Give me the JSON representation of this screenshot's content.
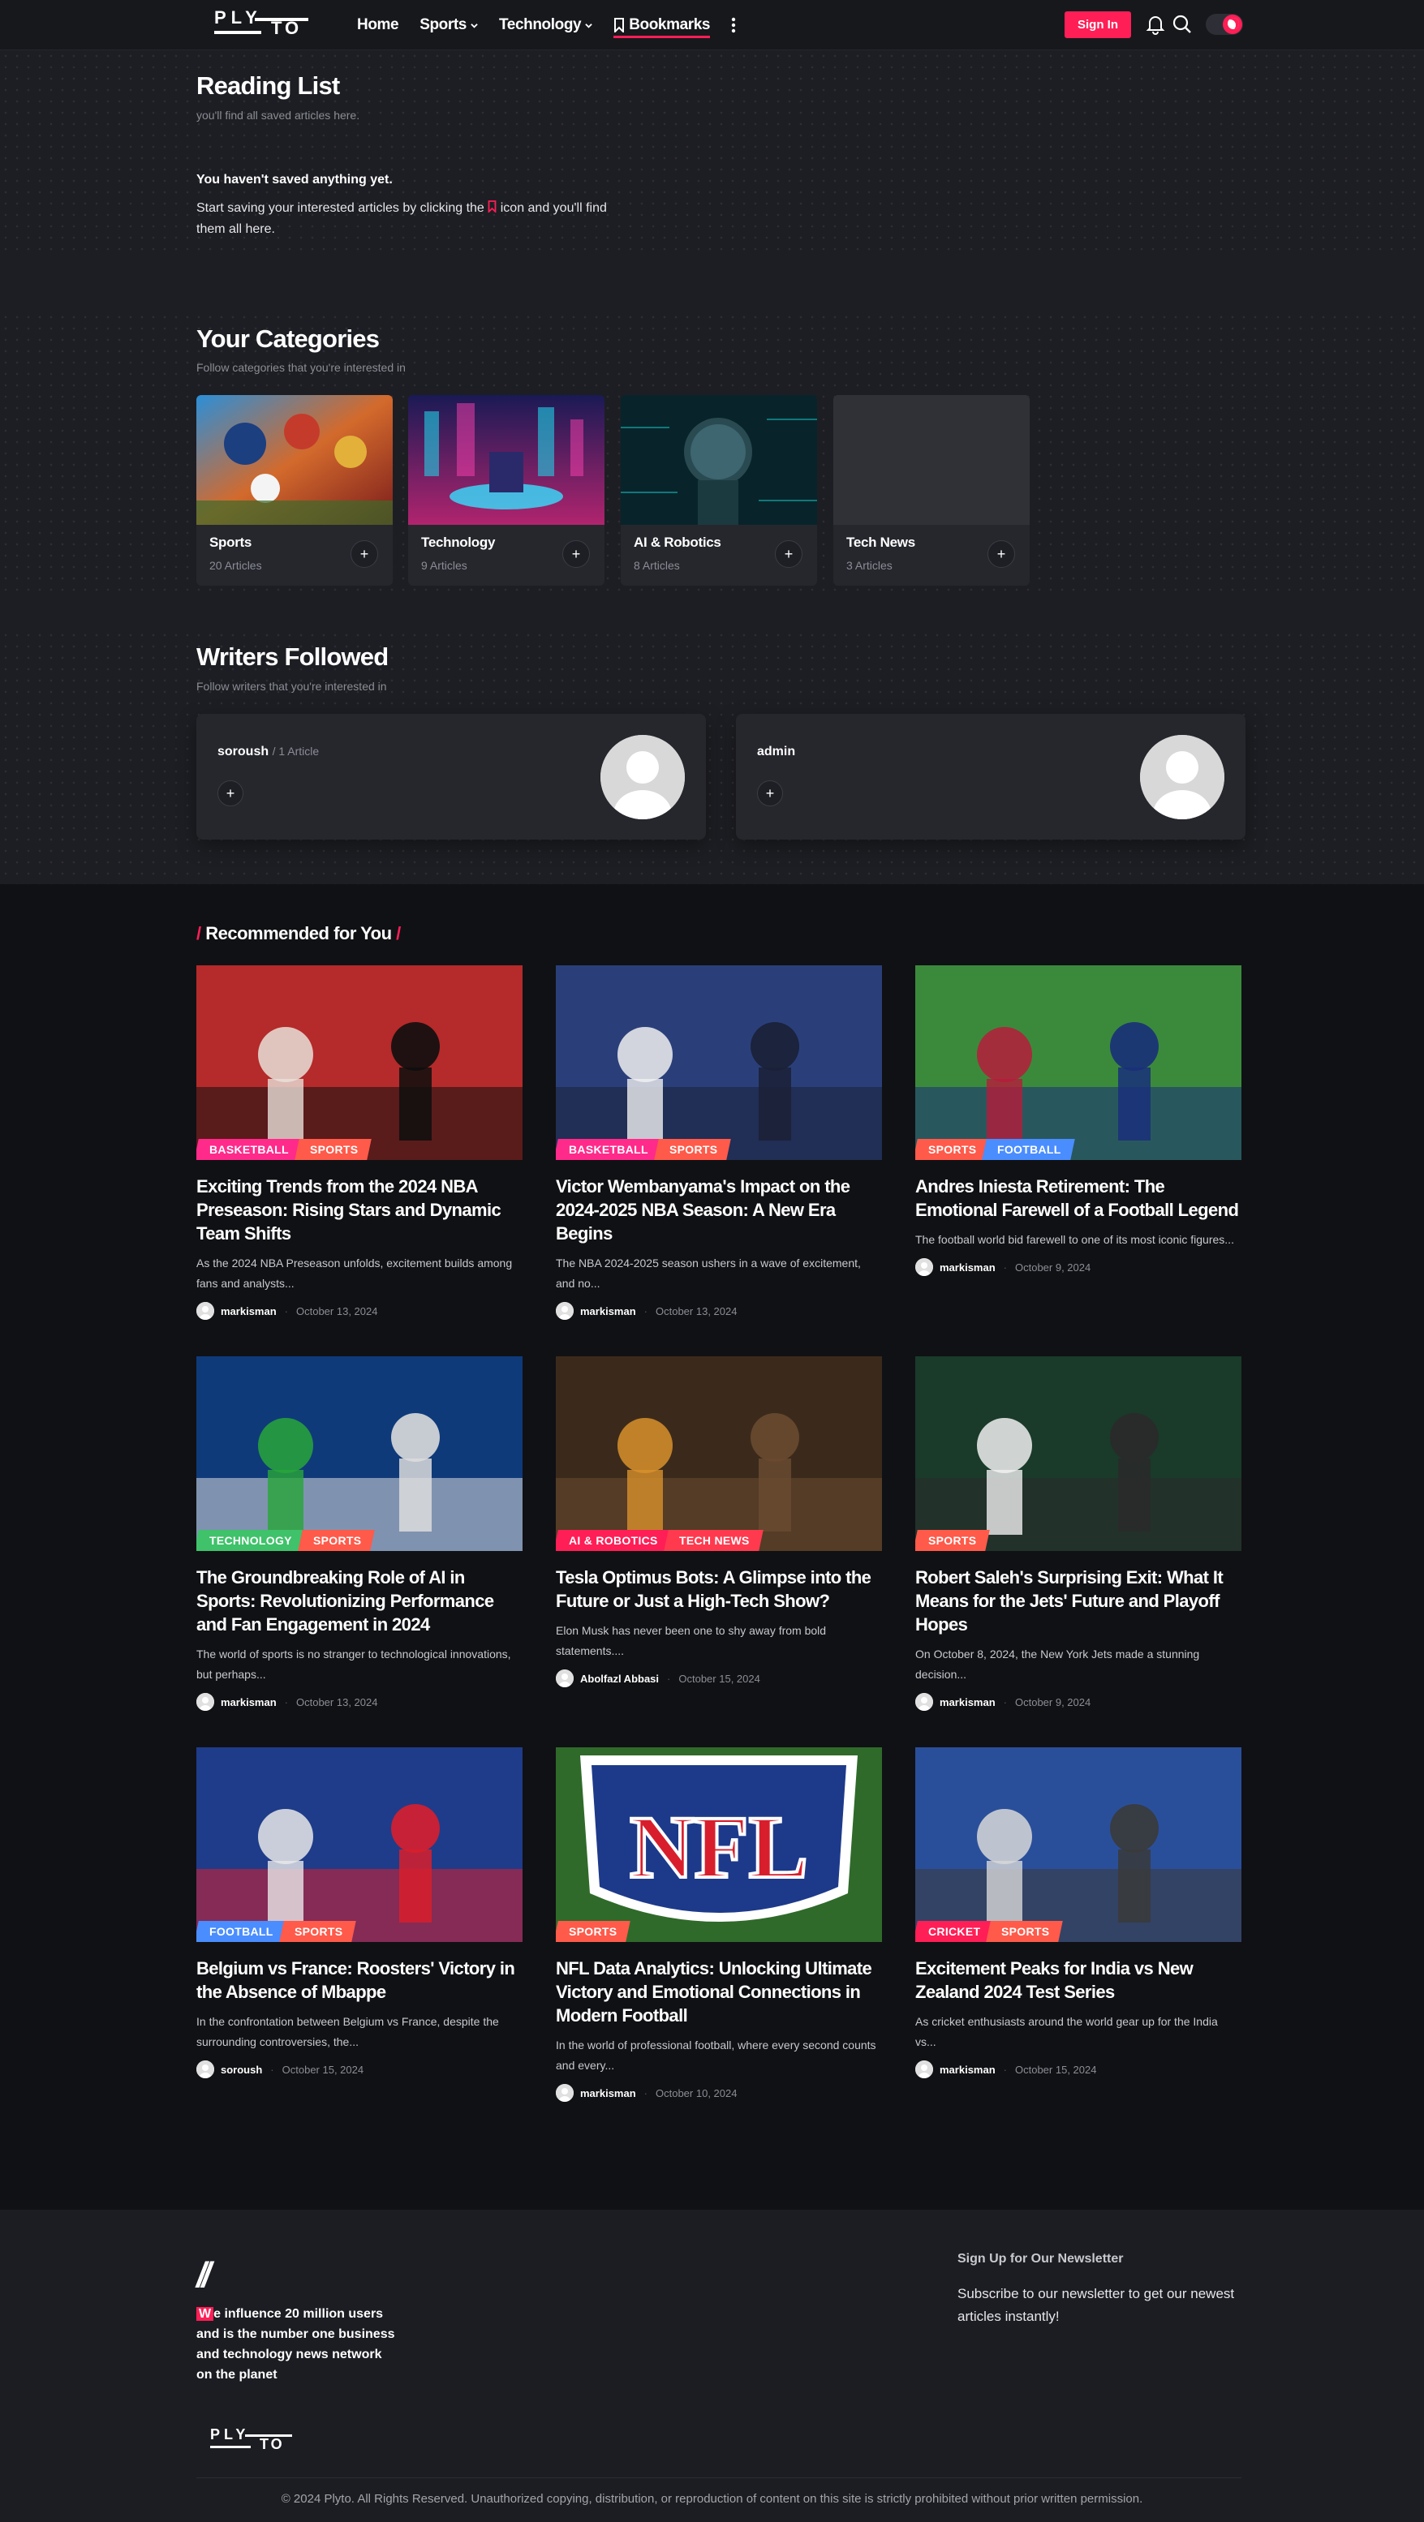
{
  "header": {
    "logo_text": "PLYTO",
    "nav": [
      {
        "label": "Home",
        "has_chevron": false
      },
      {
        "label": "Sports",
        "has_chevron": true
      },
      {
        "label": "Technology",
        "has_chevron": true
      },
      {
        "label": "Bookmarks",
        "has_chevron": false,
        "active": true
      }
    ],
    "signin_label": "Sign In",
    "accent_color": "#ff1e56"
  },
  "reading_list": {
    "title": "Reading List",
    "subtitle": "you'll find all saved articles here.",
    "empty_title": "You haven't saved anything yet.",
    "empty_text_before": "Start saving your interested articles by clicking the",
    "empty_text_after": "icon and you'll find them all here."
  },
  "categories": {
    "title": "Your Categories",
    "subtitle": "Follow categories that you're interested in",
    "items": [
      {
        "name": "Sports",
        "count": "20 Articles"
      },
      {
        "name": "Technology",
        "count": "9 Articles"
      },
      {
        "name": "AI & Robotics",
        "count": "8 Articles"
      },
      {
        "name": "Tech News",
        "count": "3 Articles"
      }
    ]
  },
  "writers": {
    "title": "Writers Followed",
    "subtitle": "Follow writers that you're interested in",
    "items": [
      {
        "name": "soroush",
        "meta": "/ 1 Article"
      },
      {
        "name": "admin",
        "meta": ""
      }
    ]
  },
  "recommended": {
    "title": "Recommended for You",
    "tag_colors": {
      "BASKETBALL": "#ff2a8a",
      "SPORTS": "#ff5a4a",
      "FOOTBALL": "#4a8dff",
      "TECHNOLOGY": "#3fc26a",
      "AI & ROBOTICS": "#ff1e56",
      "TECH NEWS": "#ff3a4f",
      "CRICKET": "#ff1e56"
    },
    "posts": [
      {
        "tags": [
          "BASKETBALL",
          "SPORTS"
        ],
        "title": "Exciting Trends from the 2024 NBA Preseason: Rising Stars and Dynamic Team Shifts",
        "excerpt": "As the 2024 NBA Preseason unfolds, excitement builds among fans and analysts...",
        "author": "markisman",
        "date": "October 13, 2024"
      },
      {
        "tags": [
          "BASKETBALL",
          "SPORTS"
        ],
        "title": "Victor Wembanyama's Impact on the 2024-2025 NBA Season: A New Era Begins",
        "excerpt": "The NBA 2024-2025 season ushers in a wave of excitement, and no...",
        "author": "markisman",
        "date": "October 13, 2024"
      },
      {
        "tags": [
          "SPORTS",
          "FOOTBALL"
        ],
        "title": "Andres Iniesta Retirement: The Emotional Farewell of a Football Legend",
        "excerpt": "The football world bid farewell to one of its most iconic figures...",
        "author": "markisman",
        "date": "October 9, 2024"
      },
      {
        "tags": [
          "TECHNOLOGY",
          "SPORTS"
        ],
        "title": "The Groundbreaking Role of AI in Sports: Revolutionizing Performance and Fan Engagement in 2024",
        "excerpt": "The world of sports is no stranger to technological innovations, but perhaps...",
        "author": "markisman",
        "date": "October 13, 2024"
      },
      {
        "tags": [
          "AI & ROBOTICS",
          "TECH NEWS"
        ],
        "title": "Tesla Optimus Bots: A Glimpse into the Future or Just a High-Tech Show?",
        "excerpt": "Elon Musk has never been one to shy away from bold statements....",
        "author": "Abolfazl Abbasi",
        "date": "October 15, 2024"
      },
      {
        "tags": [
          "SPORTS"
        ],
        "title": "Robert Saleh's Surprising Exit: What It Means for the Jets' Future and Playoff Hopes",
        "excerpt": "On October 8, 2024, the New York Jets made a stunning decision...",
        "author": "markisman",
        "date": "October 9, 2024"
      },
      {
        "tags": [
          "FOOTBALL",
          "SPORTS"
        ],
        "title": "Belgium vs France: Roosters' Victory in the Absence of Mbappe",
        "excerpt": "In the confrontation between Belgium vs France, despite the surrounding controversies, the...",
        "author": "soroush",
        "date": "October 15, 2024"
      },
      {
        "tags": [
          "SPORTS"
        ],
        "title": "NFL Data Analytics: Unlocking Ultimate Victory and Emotional Connections in Modern Football",
        "excerpt": "In the world of professional football, where every second counts and every...",
        "author": "markisman",
        "date": "October 10, 2024"
      },
      {
        "tags": [
          "CRICKET",
          "SPORTS"
        ],
        "title": "Excitement Peaks for India vs New Zealand 2024 Test Series",
        "excerpt": "As cricket enthusiasts around the world gear up for the India vs...",
        "author": "markisman",
        "date": "October 15, 2024"
      }
    ]
  },
  "footer": {
    "slash": "//",
    "about_first": "W",
    "about_rest": "e influence 20 million users and is the number one business and technology news network on the planet",
    "newsletter_title": "Sign Up for Our Newsletter",
    "newsletter_text": "Subscribe to our newsletter to get our newest articles instantly!",
    "copyright": "© 2024 Plyto. All Rights Reserved. Unauthorized copying, distribution, or reproduction of content on this site is strictly prohibited without prior written permission."
  }
}
